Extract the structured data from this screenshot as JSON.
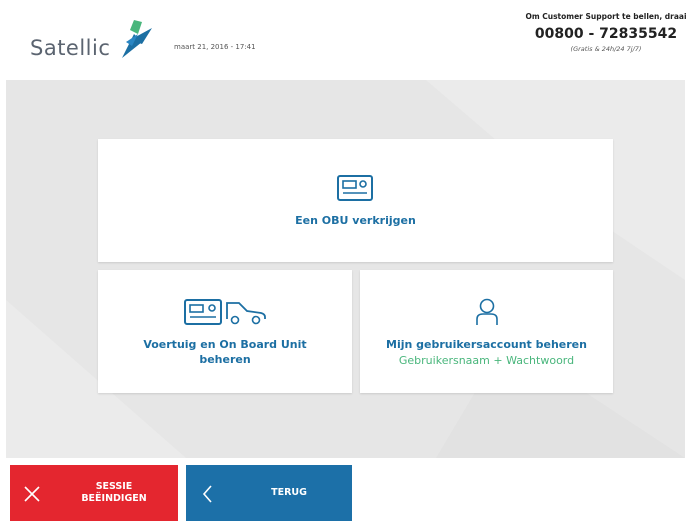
{
  "header": {
    "logo_text": "Satellic",
    "datetime": "maart 21, 2016 - 17:41",
    "support_title": "Om Customer Support te bellen, draai",
    "support_phone": "00800 - 72835542",
    "support_note": "(Gratis & 24h/24 7j/7)"
  },
  "tiles": {
    "obu": {
      "label": "Een OBU verkrijgen",
      "icon": "obu-device-icon"
    },
    "vehicle": {
      "label_line1": "Voertuig en On Board Unit",
      "label_line2": "beheren",
      "icon": "obu-vehicle-icon"
    },
    "account": {
      "label": "Mijn gebruikersaccount beheren",
      "sub": "Gebruikersnaam + Wachtwoord",
      "icon": "user-icon"
    }
  },
  "footer": {
    "end_session_line1": "SESSIE",
    "end_session_line2": "BEËINDIGEN",
    "back": "TERUG"
  },
  "colors": {
    "brand_blue": "#1c6fa3",
    "brand_green": "#49b67c",
    "end_red": "#e4262f",
    "back_blue": "#1c70a8"
  }
}
